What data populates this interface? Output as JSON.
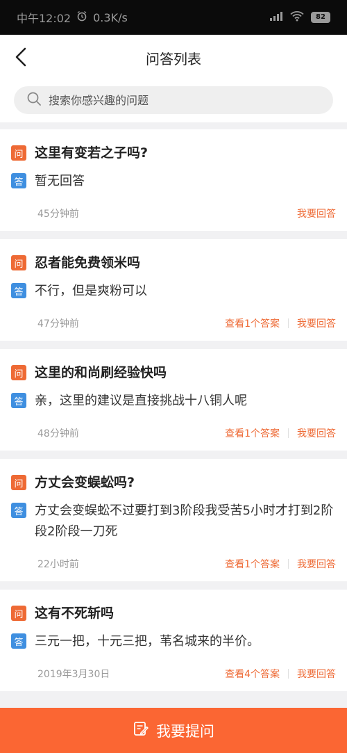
{
  "status_bar": {
    "time": "中午12:02",
    "network_speed": "0.3K/s",
    "battery": "82"
  },
  "nav": {
    "title": "问答列表"
  },
  "search": {
    "placeholder": "搜索你感兴趣的问题"
  },
  "tags": {
    "question": "问",
    "answer": "答"
  },
  "questions": [
    {
      "question": "这里有变若之子吗?",
      "answer": "暂无回答",
      "time": "45分钟前",
      "view_answers": "",
      "reply": "我要回答"
    },
    {
      "question": "忍者能免费领米吗",
      "answer": "不行，但是爽粉可以",
      "time": "47分钟前",
      "view_answers": "查看1个答案",
      "reply": "我要回答"
    },
    {
      "question": "这里的和尚刷经验快吗",
      "answer": "亲，这里的建议是直接挑战十八铜人呢",
      "time": "48分钟前",
      "view_answers": "查看1个答案",
      "reply": "我要回答"
    },
    {
      "question": "方丈会变蜈蚣吗?",
      "answer": "方丈会变蜈蚣不过要打到3阶段我受苦5小时才打到2阶段2阶段一刀死",
      "time": "22小时前",
      "view_answers": "查看1个答案",
      "reply": "我要回答"
    },
    {
      "question": "这有不死斩吗",
      "answer": "三元一把，十元三把，苇名城来的半价。",
      "time": "2019年3月30日",
      "view_answers": "查看4个答案",
      "reply": "我要回答"
    }
  ],
  "bottom": {
    "ask_label": "我要提问"
  },
  "colors": {
    "accent": "#fb6633",
    "question_tag": "#ee6a35",
    "answer_tag": "#3f8fe0"
  }
}
